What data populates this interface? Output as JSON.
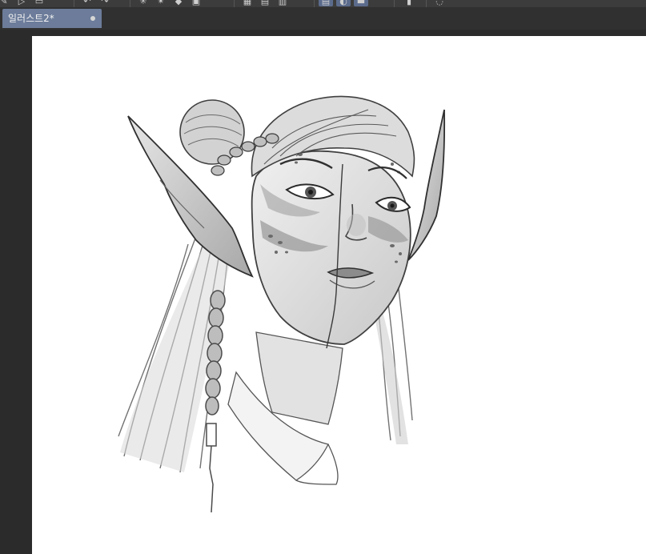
{
  "toolbar": {
    "buttons": [
      {
        "icon": "pen-icon"
      },
      {
        "icon": "play-icon"
      },
      {
        "icon": "rectangle-icon"
      },
      {
        "icon": "undo-icon"
      },
      {
        "icon": "redo-icon"
      },
      {
        "icon": "snap-icon"
      },
      {
        "icon": "snap-alt-icon"
      },
      {
        "icon": "fill-icon"
      },
      {
        "icon": "transform-icon"
      },
      {
        "icon": "grid-icon"
      },
      {
        "icon": "ruler-icon"
      },
      {
        "icon": "align-icon"
      },
      {
        "icon": "rotate-icon"
      },
      {
        "icon": "view-icon"
      },
      {
        "icon": "layer-icon"
      },
      {
        "icon": "comment-icon"
      }
    ],
    "active_color": "#5b6b8c"
  },
  "document_tab": {
    "title": "일러스트2*"
  },
  "canvas": {
    "background": "#ffffff",
    "artwork": "elf-portrait-sketch"
  }
}
